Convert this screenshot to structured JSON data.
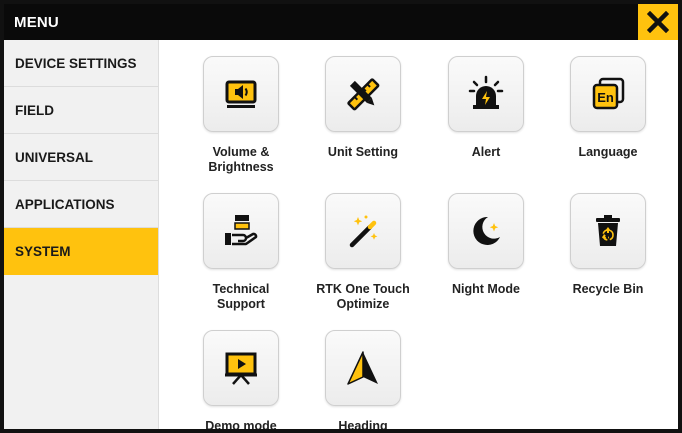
{
  "header": {
    "title": "MENU",
    "close_icon": "close-x-icon",
    "accent_color": "#ffc20e"
  },
  "sidebar": {
    "items": [
      {
        "label": "DEVICE SETTINGS",
        "active": false
      },
      {
        "label": "FIELD",
        "active": false
      },
      {
        "label": "UNIVERSAL",
        "active": false
      },
      {
        "label": "APPLICATIONS",
        "active": false
      },
      {
        "label": "SYSTEM",
        "active": true
      }
    ]
  },
  "tiles": [
    {
      "label": "Volume &\nBrightness",
      "icon": "volume-brightness-icon"
    },
    {
      "label": "Unit Setting",
      "icon": "ruler-pencil-icon"
    },
    {
      "label": "Alert",
      "icon": "alarm-icon"
    },
    {
      "label": "Language",
      "icon": "language-icon"
    },
    {
      "label": "Technical\nSupport",
      "icon": "support-hand-icon"
    },
    {
      "label": "RTK One Touch\nOptimize",
      "icon": "magic-wand-icon"
    },
    {
      "label": "Night Mode",
      "icon": "moon-icon"
    },
    {
      "label": "Recycle Bin",
      "icon": "recycle-bin-icon"
    },
    {
      "label": "Demo mode",
      "icon": "presentation-icon"
    },
    {
      "label": "Heading",
      "icon": "heading-arrow-icon"
    }
  ],
  "icon_glyph": {
    "language": "En"
  }
}
